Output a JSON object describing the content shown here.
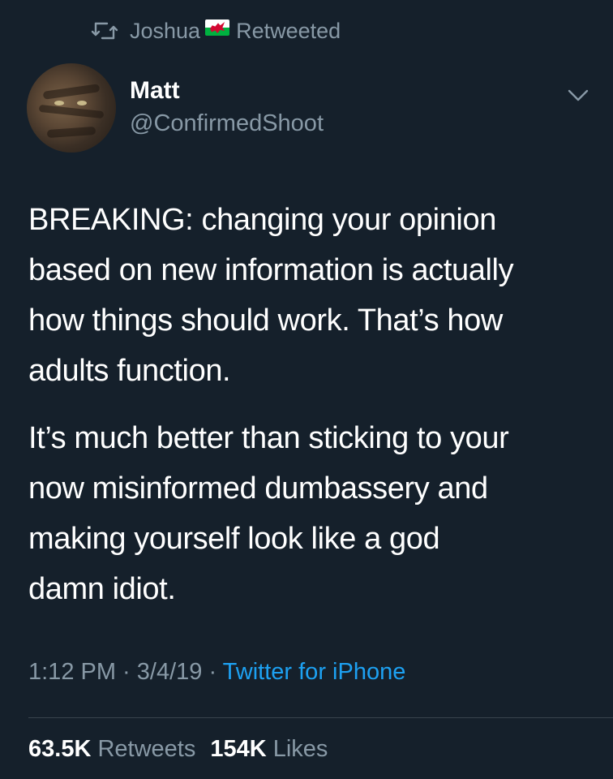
{
  "retweet_context": {
    "icon": "retweet-icon",
    "user": "Joshua",
    "flag": "wales-flag-emoji",
    "label": "Retweeted"
  },
  "author": {
    "display_name": "Matt",
    "handle": "@ConfirmedShoot",
    "avatar": "cat-avatar"
  },
  "tweet": {
    "paragraphs": [
      "BREAKING: changing your opinion\nbased on new information is actually\nhow things should work. That’s how\nadults function.",
      "It’s much better than sticking to your\nnow misinformed dumbassery and\nmaking yourself look like a god\ndamn idiot."
    ],
    "time": "1:12 PM",
    "separator": " · ",
    "date": "3/4/19",
    "source": "Twitter for iPhone"
  },
  "stats": {
    "retweets_count": "63.5K",
    "retweets_label": "Retweets",
    "likes_count": "154K",
    "likes_label": "Likes"
  },
  "colors": {
    "background": "#15202b",
    "primary_text": "#ffffff",
    "secondary_text": "#8899a6",
    "link": "#1da1f2",
    "divider": "#38444d"
  }
}
